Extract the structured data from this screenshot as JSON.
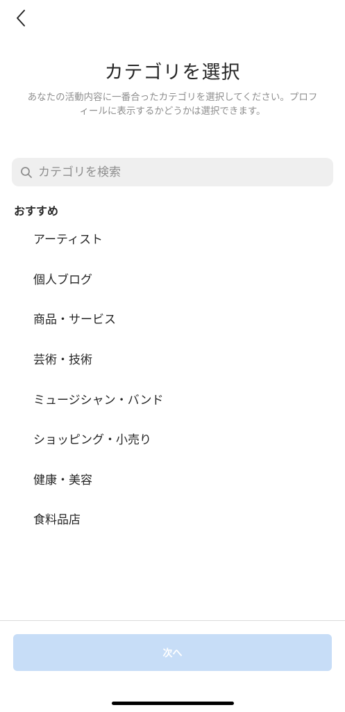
{
  "header": {
    "title": "カテゴリを選択",
    "subtitle": "あなたの活動内容に一番合ったカテゴリを選択してください。プロフィールに表示するかどうかは選択できます。"
  },
  "search": {
    "placeholder": "カテゴリを検索",
    "value": ""
  },
  "recommended": {
    "heading": "おすすめ",
    "items": [
      {
        "label": "アーティスト"
      },
      {
        "label": "個人ブログ"
      },
      {
        "label": "商品・サービス"
      },
      {
        "label": "芸術・技術"
      },
      {
        "label": "ミュージシャン・バンド"
      },
      {
        "label": "ショッピング・小売り"
      },
      {
        "label": "健康・美容"
      },
      {
        "label": "食料品店"
      }
    ]
  },
  "footer": {
    "next_label": "次へ"
  },
  "icons": {
    "back": "chevron-left-icon",
    "search": "search-icon"
  },
  "colors": {
    "button_disabled": "#c7ddf7",
    "search_background": "#efefef",
    "secondary_text": "#8e8e8e"
  }
}
